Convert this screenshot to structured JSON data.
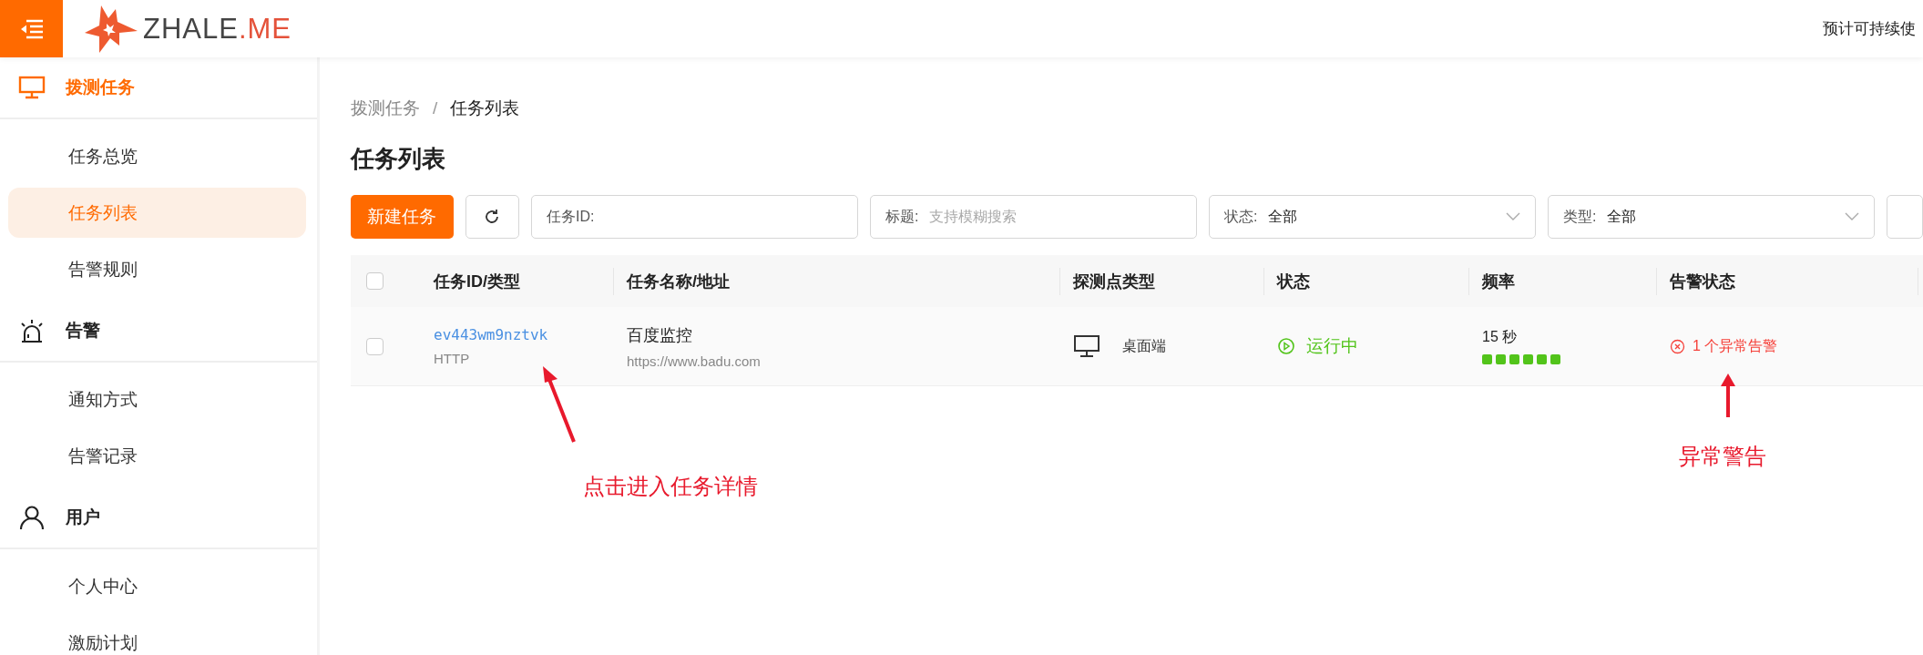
{
  "header": {
    "logo_text": "ZHALE",
    "logo_suffix": ".ME",
    "right_text": "预计可持续使"
  },
  "sidebar": {
    "groups": [
      {
        "title": "拨测任务",
        "kind": "monitor",
        "active": true,
        "items": [
          {
            "label": "任务总览",
            "selected": false
          },
          {
            "label": "任务列表",
            "selected": true
          },
          {
            "label": "告警规则",
            "selected": false
          }
        ]
      },
      {
        "title": "告警",
        "kind": "alarm",
        "active": false,
        "items": [
          {
            "label": "通知方式",
            "selected": false
          },
          {
            "label": "告警记录",
            "selected": false
          }
        ]
      },
      {
        "title": "用户",
        "kind": "user",
        "active": false,
        "items": [
          {
            "label": "个人中心",
            "selected": false
          },
          {
            "label": "激励计划",
            "selected": false
          }
        ]
      }
    ]
  },
  "breadcrumb": [
    "拨测任务",
    "任务列表"
  ],
  "breadcrumb_separator": "/",
  "page_title": "任务列表",
  "toolbar": {
    "new_button": "新建任务"
  },
  "filters": [
    {
      "kind": "input",
      "label": "任务ID:"
    },
    {
      "kind": "input",
      "label": "标题:",
      "placeholder": "支持模糊搜索"
    },
    {
      "kind": "select",
      "label": "状态:",
      "value": "全部"
    },
    {
      "kind": "select",
      "label": "类型:",
      "value": "全部"
    }
  ],
  "table": {
    "header_checked": false,
    "columns": [
      "任务ID/类型",
      "任务名称/地址",
      "探测点类型",
      "状态",
      "频率",
      "告警状态"
    ],
    "rows": [
      {
        "checked": false,
        "id": "ev443wm9nztvk",
        "type": "HTTP",
        "name": "百度监控",
        "url": "https://www.badu.com",
        "probe": "桌面端",
        "status": "运行中",
        "frequency": "15 秒",
        "alarm": "1 个异常告警"
      }
    ]
  },
  "annotations": [
    {
      "text": "点击进入任务详情",
      "kind": "id"
    },
    {
      "text": "异常警告",
      "kind": "alarm"
    }
  ]
}
